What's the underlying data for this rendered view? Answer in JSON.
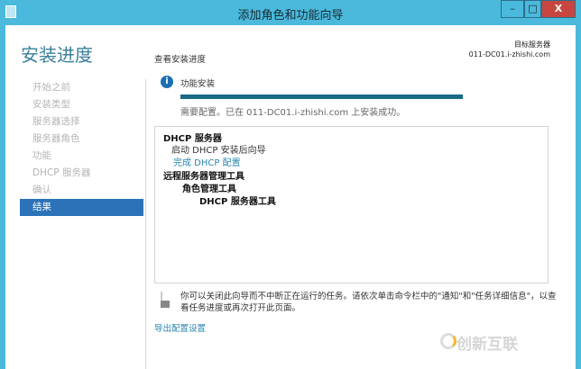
{
  "window": {
    "title": "添加角色和功能向导",
    "minimize": "–",
    "maximize": "□",
    "close": "X"
  },
  "page": {
    "heading": "安装进度",
    "target_label": "目标服务器",
    "target_server": "011-DC01.i-zhishi.com"
  },
  "nav": {
    "items": [
      {
        "label": "开始之前",
        "selected": false
      },
      {
        "label": "安装类型",
        "selected": false
      },
      {
        "label": "服务器选择",
        "selected": false
      },
      {
        "label": "服务器角色",
        "selected": false
      },
      {
        "label": "功能",
        "selected": false
      },
      {
        "label": "DHCP 服务器",
        "selected": false
      },
      {
        "label": "确认",
        "selected": false
      },
      {
        "label": "结果",
        "selected": true
      }
    ]
  },
  "main": {
    "subtitle": "查看安装进度",
    "feature_label": "功能安装",
    "progress_percent": 100,
    "status": "需要配置。已在 011-DC01.i-zhishi.com 上安装成功。",
    "results": {
      "dhcp_server": "DHCP 服务器",
      "post_wizard": "启动 DHCP 安装后向导",
      "complete_link": "完成 DHCP 配置",
      "rsat": "远程服务器管理工具",
      "role_tools": "角色管理工具",
      "dhcp_tools": "DHCP 服务器工具"
    },
    "note": "你可以关闭此向导而不中断正在运行的任务。请依次单击命令栏中的\"通知\"和\"任务详细信息\"，以查看任务进度或再次打开此页面。",
    "export_link": "导出配置设置"
  },
  "watermark": "创新互联"
}
